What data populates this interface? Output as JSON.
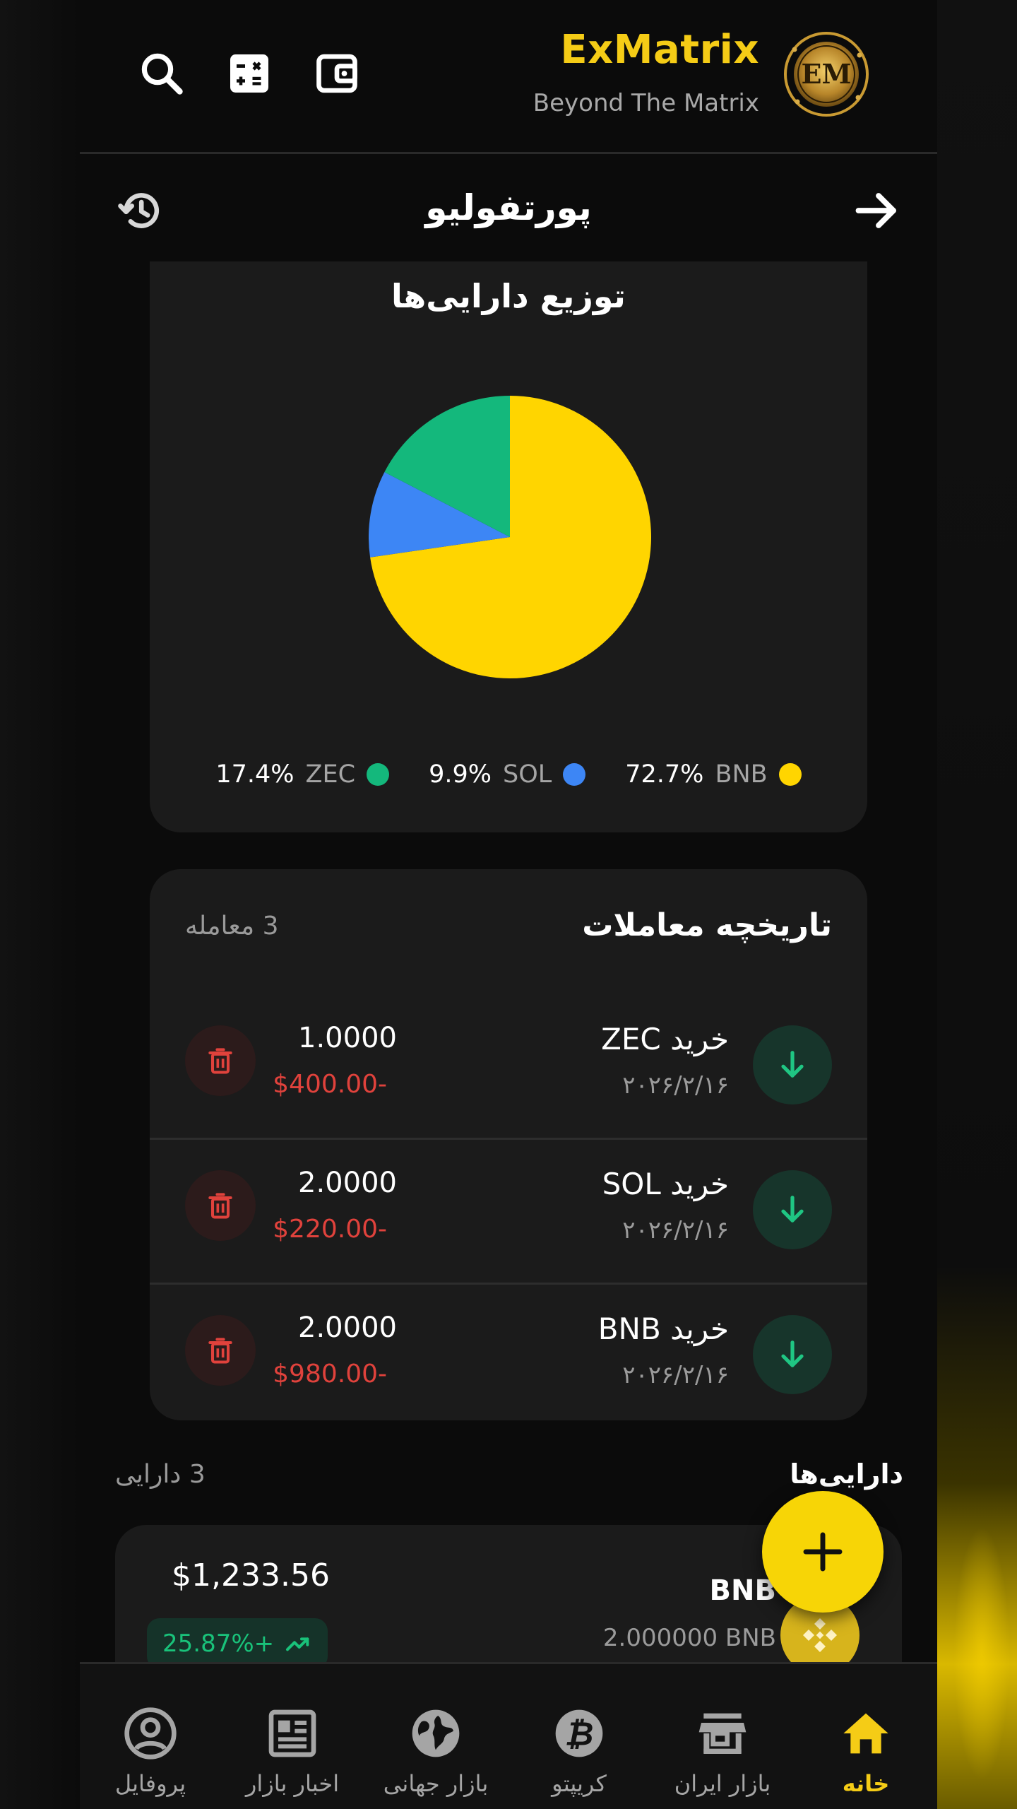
{
  "brand": {
    "title": "ExMatrix",
    "subtitle": "Beyond The Matrix",
    "logo_text": "EM",
    "accent": "#f5cc16"
  },
  "header_icons": [
    "search-icon",
    "calculator-icon",
    "wallet-icon"
  ],
  "titlebar": {
    "title": "پورتفولیو",
    "left_icon": "history-icon",
    "right_icon": "arrow-right-icon"
  },
  "distribution": {
    "title": "توزیع دارایی‌ها",
    "chart_data": {
      "type": "pie",
      "categories": [
        "BNB",
        "SOL",
        "ZEC"
      ],
      "values": [
        72.7,
        9.9,
        17.4
      ],
      "colors": [
        "#ffd500",
        "#3d86f5",
        "#14b87c"
      ],
      "legend": "bottom"
    },
    "legend": [
      {
        "name": "BNB",
        "pct": "72.7%",
        "color": "#ffd500"
      },
      {
        "name": "SOL",
        "pct": "9.9%",
        "color": "#3d86f5"
      },
      {
        "name": "ZEC",
        "pct": "17.4%",
        "color": "#14b87c"
      }
    ]
  },
  "transactions": {
    "title": "تاریخچه معاملات",
    "count": "3 معامله",
    "rows": [
      {
        "label": "خرید ZEC",
        "date": "۲۰۲۶/۲/۱۶",
        "qty": "1.0000",
        "amount": "$400.00-"
      },
      {
        "label": "خرید SOL",
        "date": "۲۰۲۶/۲/۱۶",
        "qty": "2.0000",
        "amount": "$220.00-"
      },
      {
        "label": "خرید BNB",
        "date": "۲۰۲۶/۲/۱۶",
        "qty": "2.0000",
        "amount": "$980.00-"
      }
    ]
  },
  "assets": {
    "title": "دارایی‌ها",
    "count": "3 دارایی",
    "items": [
      {
        "name": "BNB",
        "qty": "2.000000 BNB",
        "value": "$1,233.56",
        "change": "25.87%+"
      }
    ]
  },
  "fab": {
    "icon": "plus-icon"
  },
  "nav": [
    {
      "label": "خانه",
      "icon": "home-icon",
      "active": true
    },
    {
      "label": "بازار ایران",
      "icon": "store-icon",
      "active": false
    },
    {
      "label": "کریپتو",
      "icon": "bitcoin-icon",
      "active": false
    },
    {
      "label": "بازار جهانی",
      "icon": "globe-icon",
      "active": false
    },
    {
      "label": "اخبار بازار",
      "icon": "news-icon",
      "active": false
    },
    {
      "label": "پروفایل",
      "icon": "profile-icon",
      "active": false
    }
  ]
}
